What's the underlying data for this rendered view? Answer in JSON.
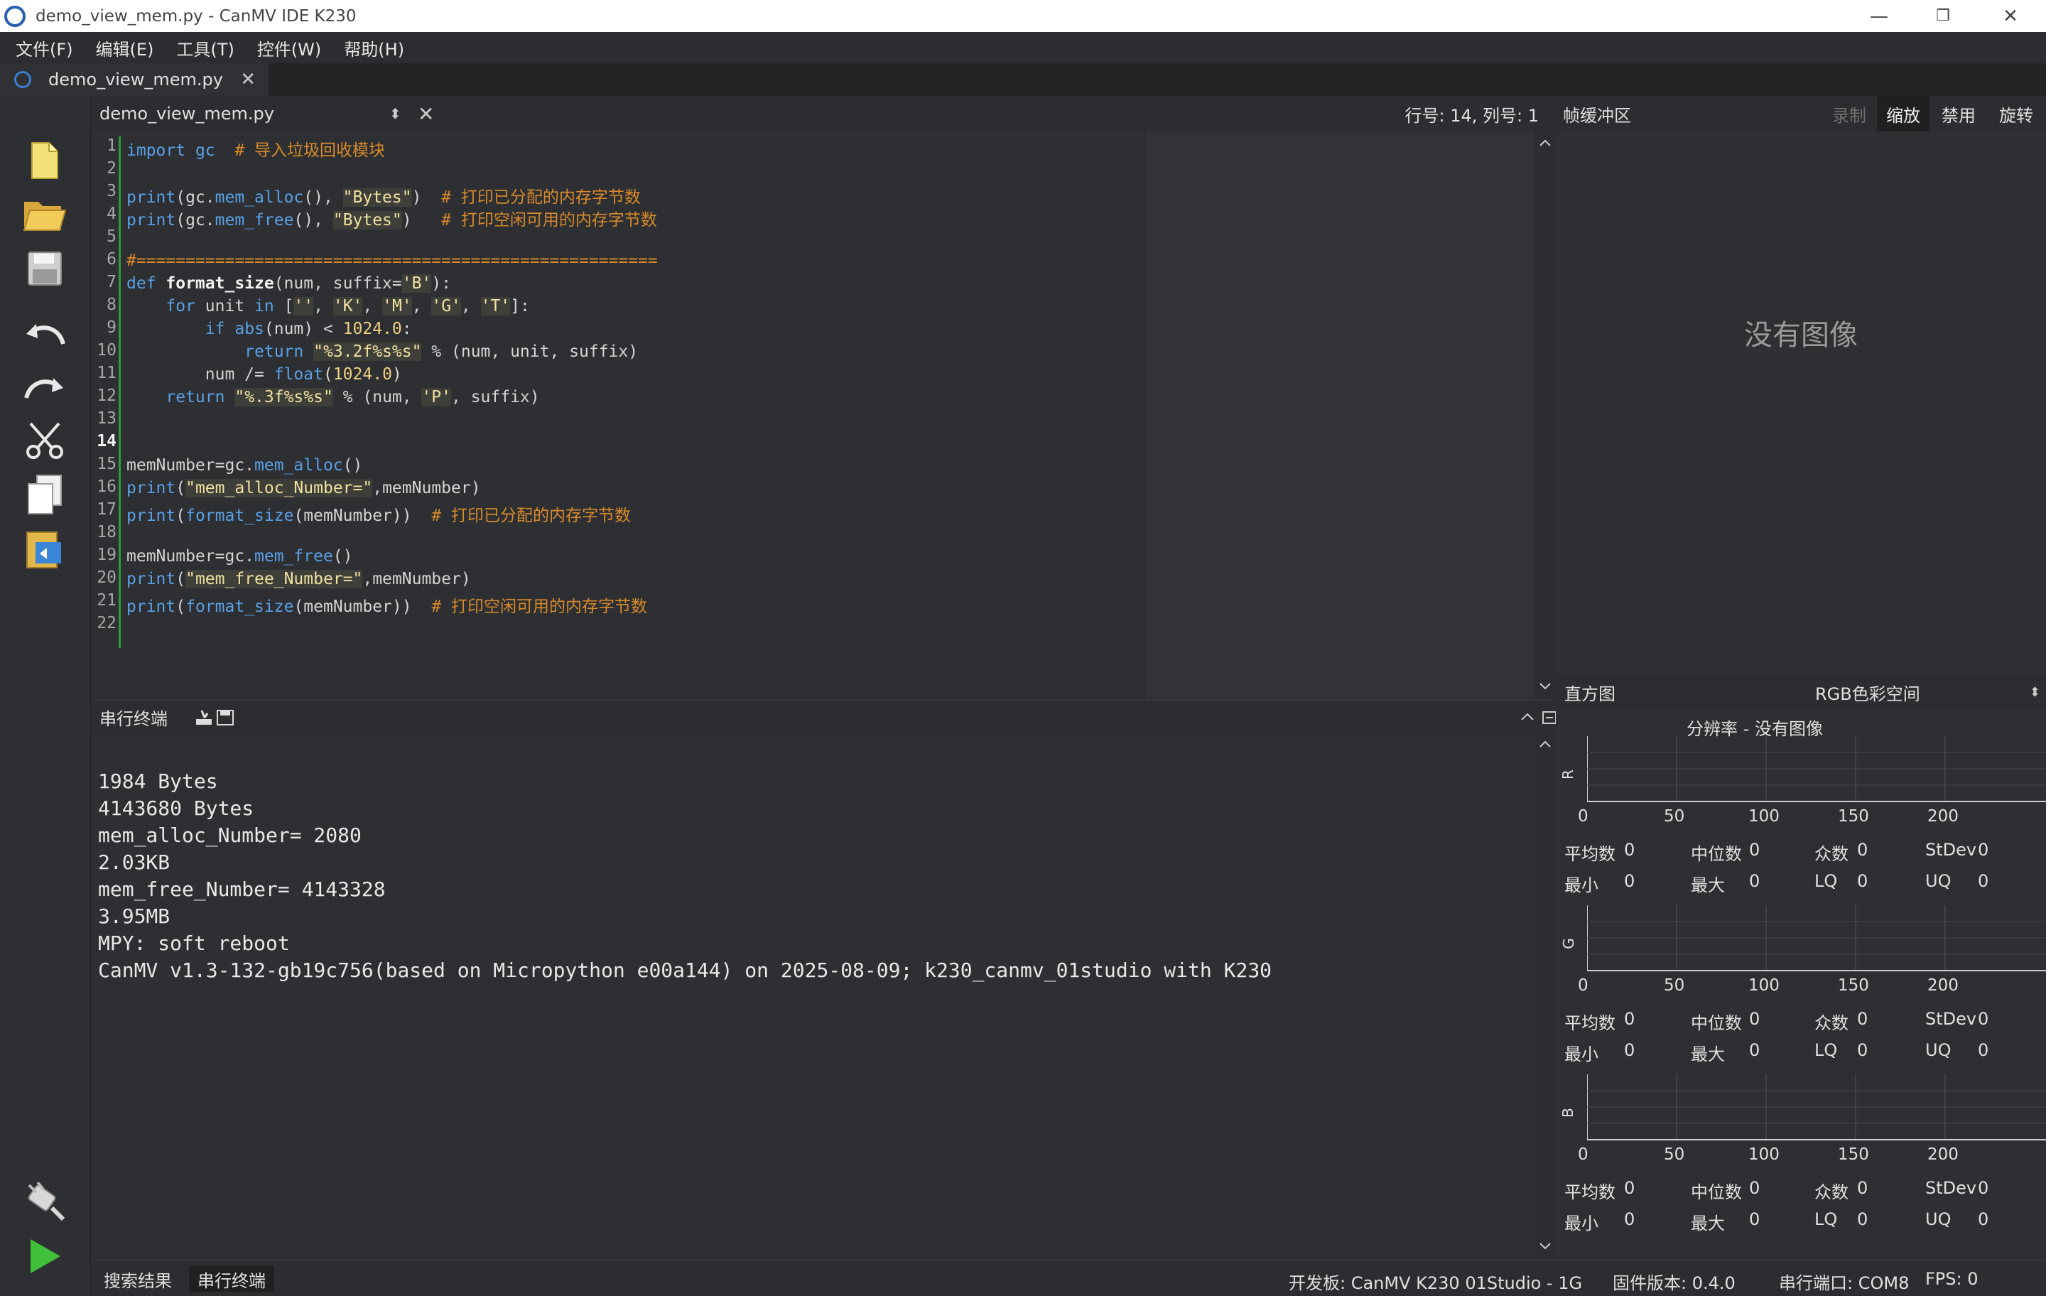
{
  "window": {
    "title": "demo_view_mem.py - CanMV IDE K230",
    "minimize": "—",
    "maximize": "❐",
    "close": "✕"
  },
  "menu": [
    "文件(F)",
    "编辑(E)",
    "工具(T)",
    "控件(W)",
    "帮助(H)"
  ],
  "tab": {
    "label": "demo_view_mem.py",
    "close": "✕"
  },
  "editor": {
    "filename": "demo_view_mem.py",
    "updown": "⬍",
    "close": "✕",
    "position": "行号: 14, 列号: 1",
    "current_line": 14
  },
  "code_lines": [
    {
      "n": "1"
    },
    {
      "n": "2"
    },
    {
      "n": "3"
    },
    {
      "n": "4"
    },
    {
      "n": "5"
    },
    {
      "n": "6"
    },
    {
      "n": "7"
    },
    {
      "n": "8"
    },
    {
      "n": "9"
    },
    {
      "n": "10"
    },
    {
      "n": "11"
    },
    {
      "n": "12"
    },
    {
      "n": "13"
    },
    {
      "n": "14"
    },
    {
      "n": "15"
    },
    {
      "n": "16"
    },
    {
      "n": "17"
    },
    {
      "n": "18"
    },
    {
      "n": "19"
    },
    {
      "n": "20"
    },
    {
      "n": "21"
    },
    {
      "n": "22"
    }
  ],
  "code": {
    "l1_kw": "import",
    "l1_mod": " gc  ",
    "l1_cm": "# 导入垃圾回收模块",
    "l3_a": "print",
    "l3_b": "(gc.",
    "l3_c": "mem_alloc",
    "l3_d": "(), ",
    "l3_s": "\"Bytes\"",
    "l3_e": ")  ",
    "l3_cm": "# 打印已分配的内存字节数",
    "l4_a": "print",
    "l4_b": "(gc.",
    "l4_c": "mem_free",
    "l4_d": "(), ",
    "l4_s": "\"Bytes\"",
    "l4_e": ")   ",
    "l4_cm": "# 打印空闲可用的内存字节数",
    "l6": "#=====================================================",
    "l7_kw": "def",
    "l7_fn": " format_size",
    "l7_a": "(num, suffix=",
    "l7_s": "'B'",
    "l7_b": "):",
    "l8_a": "    ",
    "l8_kw": "for",
    "l8_b": " unit ",
    "l8_kw2": "in",
    "l8_c": " [",
    "l8_s1": "''",
    "l8_s2": "'K'",
    "l8_s3": "'M'",
    "l8_s4": "'G'",
    "l8_s5": "'T'",
    "l8_d": "]:",
    "l8_comma": ", ",
    "l9_a": "        ",
    "l9_kw": "if",
    "l9_b": " ",
    "l9_fn": "abs",
    "l9_c": "(num) < ",
    "l9_n": "1024.0",
    "l9_d": ":",
    "l10_a": "            ",
    "l10_kw": "return",
    "l10_b": " ",
    "l10_s": "\"%3.2f%s%s\"",
    "l10_c": " % (num, unit, suffix)",
    "l11_a": "        num /= ",
    "l11_fn": "float",
    "l11_b": "(",
    "l11_n": "1024.0",
    "l11_c": ")",
    "l12_a": "    ",
    "l12_kw": "return",
    "l12_b": " ",
    "l12_s": "\"%.3f%s%s\"",
    "l12_c": " % (num, ",
    "l12_s2": "'P'",
    "l12_d": ", suffix)",
    "l15_a": "memNumber=gc.",
    "l15_b": "mem_alloc",
    "l15_c": "()",
    "l16_a": "print",
    "l16_b": "(",
    "l16_s": "\"mem_alloc_Number=\"",
    "l16_c": ",memNumber)",
    "l17_a": "print",
    "l17_b": "(",
    "l17_c": "format_size",
    "l17_d": "(memNumber))  ",
    "l17_cm": "# 打印已分配的内存字节数",
    "l19_a": "memNumber=gc.",
    "l19_b": "mem_free",
    "l19_c": "()",
    "l20_a": "print",
    "l20_b": "(",
    "l20_s": "\"mem_free_Number=\"",
    "l20_c": ",memNumber)",
    "l21_a": "print",
    "l21_b": "(",
    "l21_c": "format_size",
    "l21_d": "(memNumber))  ",
    "l21_cm": "# 打印空闲可用的内存字节数"
  },
  "serial": {
    "label": "串行终端",
    "lines": [
      "1984 Bytes",
      "4143680 Bytes",
      "mem_alloc_Number= 2080",
      "2.03KB",
      "mem_free_Number= 4143328",
      "3.95MB",
      "MPY: soft reboot",
      "CanMV v1.3-132-gb19c756(based on Micropython e00a144) on 2025-08-09; k230_canmv_01studio with K230"
    ]
  },
  "framebuffer": {
    "label": "帧缓冲区",
    "buttons": [
      "录制",
      "缩放",
      "禁用",
      "旋转"
    ],
    "active": "缩放",
    "no_image": "没有图像"
  },
  "histogram": {
    "label": "直方图",
    "color_space": "RGB色彩空间",
    "resolution": "分辨率 - 没有图像",
    "ticks": [
      "0",
      "50",
      "100",
      "150",
      "200"
    ],
    "channels": [
      {
        "name": "R",
        "mean": "平均数",
        "mean_v": "0",
        "median": "中位数",
        "median_v": "0",
        "mode": "众数",
        "mode_v": "0",
        "stdev": "StDev",
        "stdev_v": "0",
        "min": "最小",
        "min_v": "0",
        "max": "最大",
        "max_v": "0",
        "lq": "LQ",
        "lq_v": "0",
        "uq": "UQ",
        "uq_v": "0"
      },
      {
        "name": "G",
        "mean": "平均数",
        "mean_v": "0",
        "median": "中位数",
        "median_v": "0",
        "mode": "众数",
        "mode_v": "0",
        "stdev": "StDev",
        "stdev_v": "0",
        "min": "最小",
        "min_v": "0",
        "max": "最大",
        "max_v": "0",
        "lq": "LQ",
        "lq_v": "0",
        "uq": "UQ",
        "uq_v": "0"
      },
      {
        "name": "B",
        "mean": "平均数",
        "mean_v": "0",
        "median": "中位数",
        "median_v": "0",
        "mode": "众数",
        "mode_v": "0",
        "stdev": "StDev",
        "stdev_v": "0",
        "min": "最小",
        "min_v": "0",
        "max": "最大",
        "max_v": "0",
        "lq": "LQ",
        "lq_v": "0",
        "uq": "UQ",
        "uq_v": "0"
      }
    ]
  },
  "status": {
    "tabs": [
      "搜索结果",
      "串行终端"
    ],
    "board": "开发板:  CanMV K230 01Studio - 1G",
    "firmware": "固件版本:  0.4.0",
    "port": "串行端口:  COM8",
    "fps": "FPS:  0"
  },
  "colors": {
    "accent_green": "#2e9a3a",
    "comment": "#d88a2a",
    "keyword": "#5aa0e6"
  }
}
